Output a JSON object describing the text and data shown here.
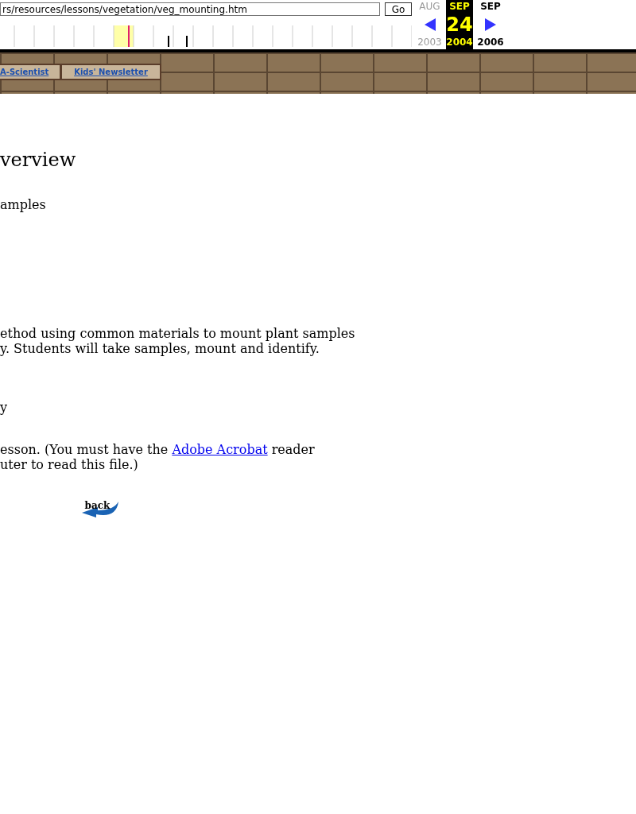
{
  "toolbar": {
    "url": "rs/resources/lessons/vegetation/veg_mounting.htm",
    "go_button": "Go",
    "calendar": [
      {
        "month": "AUG",
        "year": "2003",
        "selected": false,
        "disabled": true
      },
      {
        "month": "SEP",
        "day": "24",
        "year": "2004",
        "selected": true,
        "disabled": false
      },
      {
        "month": "SEP",
        "year": "2006",
        "selected": false,
        "disabled": false
      }
    ]
  },
  "nav_tabs": [
    "A-Scientist",
    "Kids' Newsletter"
  ],
  "heading": "verview",
  "subtitle": "amples",
  "description": "ethod using common materials to mount plant samples\ny. Students will take samples, mount and identify.",
  "fragment": "y",
  "download_note": {
    "before": "esson. (You must have the ",
    "link": "Adobe Acrobat",
    "after": " reader\nuter to read this file.)"
  },
  "back_link": "back"
}
